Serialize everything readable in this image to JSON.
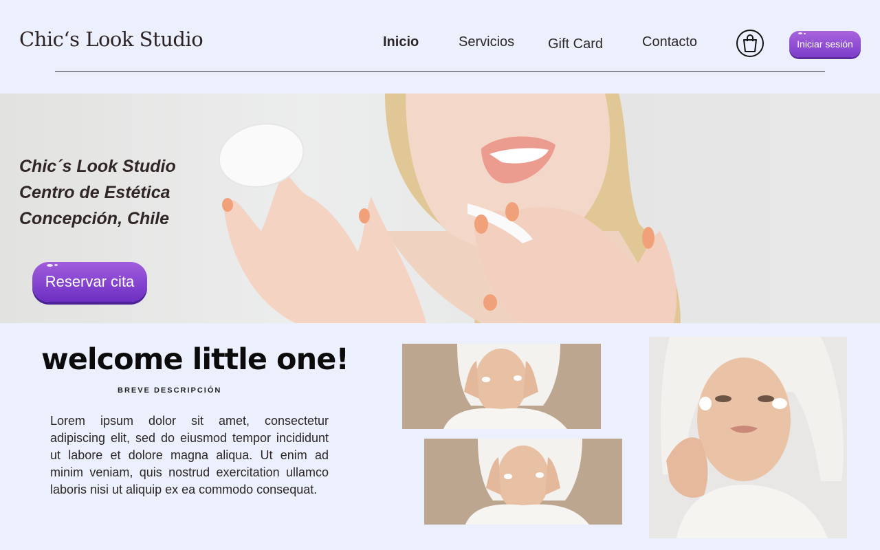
{
  "header": {
    "logo": "Chic‘s Look Studio",
    "nav": [
      {
        "label": "Inicio",
        "active": true
      },
      {
        "label": "Servicios",
        "active": false
      },
      {
        "label": "Gift Card",
        "active": false
      },
      {
        "label": "Contacto",
        "active": false
      }
    ],
    "cart_icon": "shopping-bag-icon",
    "login_label": "Iniciar sesión"
  },
  "hero": {
    "lines": [
      "Chic´s Look Studio",
      "Centro de Estética",
      "Concepción, Chile"
    ],
    "cta_label": "Reservar cita"
  },
  "intro": {
    "title": "welcome little one!",
    "subtitle": "BREVE DESCRIPCIÓN",
    "body": "Lorem ipsum dolor sit amet, consectetur adipiscing elit, sed do eiusmod tempor incididunt ut labore et dolore magna aliqua. Ut enim ad minim veniam, quis nostrud exercitation ullamco laboris nisi ut aliquip ex ea commodo consequat."
  },
  "colors": {
    "background": "#eceffc",
    "accent": "#8a4bd3",
    "photo_background": "#bba68f"
  }
}
